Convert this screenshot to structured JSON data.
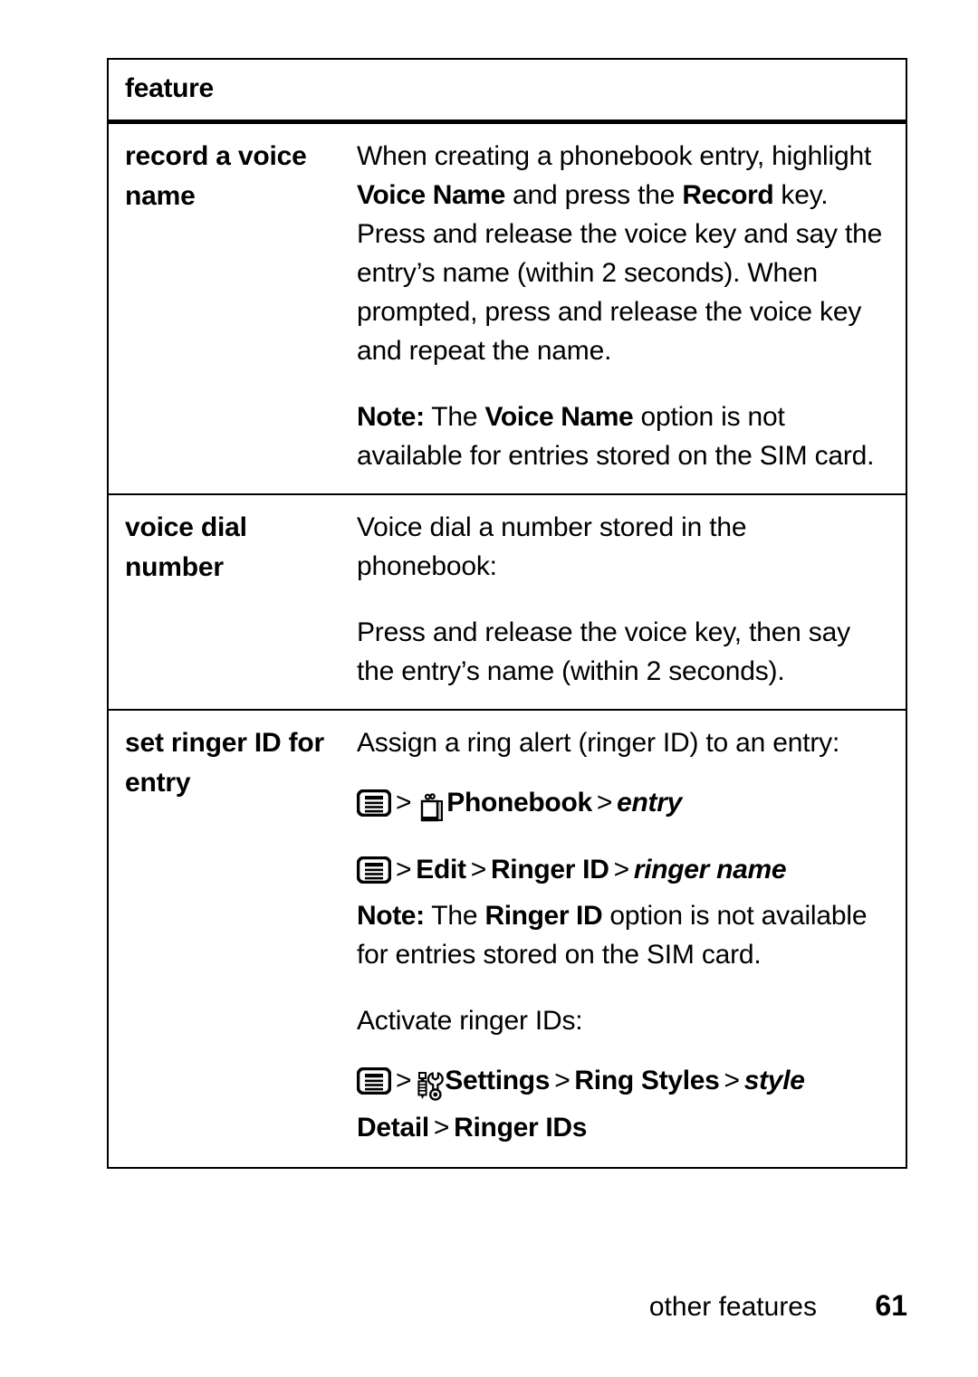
{
  "document": {
    "table": {
      "header": {
        "label": "feature"
      },
      "rows": [
        {
          "feature": "record a voice name",
          "paragraphs": [
            {
              "segments": [
                {
                  "text": "When creating a phonebook entry, highlight ",
                  "style": "normal"
                },
                {
                  "text": "Voice Name",
                  "style": "bold"
                },
                {
                  "text": " and press the ",
                  "style": "normal"
                },
                {
                  "text": "Record",
                  "style": "bold"
                },
                {
                  "text": " key. Press and release the voice key and say the entry’s name (within 2 seconds). When prompted, press and release the voice key and repeat the name.",
                  "style": "normal"
                }
              ]
            },
            {
              "segments": [
                {
                  "text": "Note:",
                  "style": "bold"
                },
                {
                  "text": " The ",
                  "style": "normal"
                },
                {
                  "text": "Voice Name",
                  "style": "bold"
                },
                {
                  "text": " option is not available for entries stored on the SIM card.",
                  "style": "normal"
                }
              ]
            }
          ],
          "nav_paths": []
        },
        {
          "feature": "voice dial number",
          "paragraphs": [
            {
              "segments": [
                {
                  "text": "Voice dial a number stored in the phonebook:",
                  "style": "normal"
                }
              ]
            },
            {
              "segments": [
                {
                  "text": "Press and release the voice key, then say the entry’s name (within 2 seconds).",
                  "style": "normal"
                }
              ]
            }
          ],
          "nav_paths": []
        },
        {
          "feature": "set ringer ID for entry",
          "paragraphs": [
            {
              "segments": [
                {
                  "text": "Assign a ring alert (ringer ID) to an entry:",
                  "style": "normal"
                }
              ]
            }
          ],
          "nav_paths": [
            {
              "items": [
                {
                  "type": "icon",
                  "icon": "menu-icon"
                },
                {
                  "type": "sep",
                  "text": ">"
                },
                {
                  "type": "icon",
                  "icon": "phonebook-icon"
                },
                {
                  "type": "bold",
                  "text": "Phonebook"
                },
                {
                  "type": "sep",
                  "text": ">"
                },
                {
                  "type": "italic",
                  "text": "entry"
                }
              ]
            },
            {
              "items": [
                {
                  "type": "icon",
                  "icon": "menu-icon"
                },
                {
                  "type": "sep",
                  "text": ">"
                },
                {
                  "type": "bold",
                  "text": "Edit"
                },
                {
                  "type": "sep",
                  "text": ">"
                },
                {
                  "type": "bold",
                  "text": "Ringer ID"
                },
                {
                  "type": "sep",
                  "text": ">"
                },
                {
                  "type": "italic",
                  "text": "ringer name"
                }
              ]
            }
          ],
          "paragraphs_after": [
            {
              "segments": [
                {
                  "text": "Note:",
                  "style": "bold"
                },
                {
                  "text": " The ",
                  "style": "normal"
                },
                {
                  "text": "Ringer ID",
                  "style": "bold"
                },
                {
                  "text": " option is not available for entries stored on the SIM card.",
                  "style": "normal"
                }
              ]
            },
            {
              "segments": [
                {
                  "text": "Activate ringer IDs:",
                  "style": "normal"
                }
              ]
            }
          ],
          "nav_paths_after": [
            {
              "items": [
                {
                  "type": "icon",
                  "icon": "menu-icon"
                },
                {
                  "type": "sep",
                  "text": ">"
                },
                {
                  "type": "icon",
                  "icon": "settings-tools-icon"
                },
                {
                  "type": "bold",
                  "text": "Settings"
                },
                {
                  "type": "sep",
                  "text": ">"
                },
                {
                  "type": "bold",
                  "text": "Ring Styles"
                },
                {
                  "type": "sep",
                  "text": ">"
                },
                {
                  "type": "italic",
                  "text": "style"
                },
                {
                  "type": "bold",
                  "text": "Detail"
                },
                {
                  "type": "sep",
                  "text": ">"
                },
                {
                  "type": "bold",
                  "text": "Ringer IDs"
                }
              ]
            }
          ]
        }
      ]
    },
    "footer": {
      "section_title": "other features",
      "page_number": "61"
    },
    "colors": {
      "text": "#000000",
      "background": "#ffffff",
      "border": "#000000"
    }
  }
}
